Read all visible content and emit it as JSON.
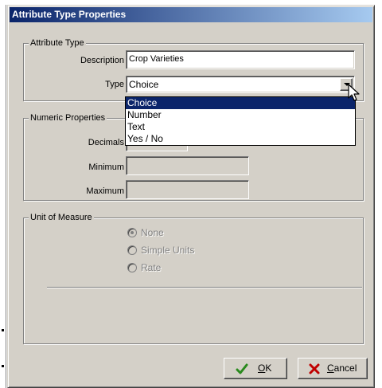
{
  "window": {
    "title": "Attribute Type Properties"
  },
  "attribute_type": {
    "legend": "Attribute Type",
    "description_label": "Description",
    "description_value": "Crop Varieties",
    "type_label": "Type",
    "type_value": "Choice",
    "type_options": [
      "Choice",
      "Number",
      "Text",
      "Yes / No"
    ],
    "type_selected_index": 0
  },
  "numeric_properties": {
    "legend": "Numeric Properties",
    "decimals_label": "Decimals",
    "minimum_label": "Minimum",
    "maximum_label": "Maximum"
  },
  "unit_of_measure": {
    "legend": "Unit of Measure",
    "options": [
      "None",
      "Simple Units",
      "Rate"
    ],
    "selected": "None"
  },
  "buttons": {
    "ok_prefix": "",
    "ok_mnemonic": "O",
    "ok_rest": "K",
    "cancel_mnemonic": "C",
    "cancel_rest": "ancel"
  },
  "icons": {
    "ok": "checkmark-icon",
    "cancel": "x-cross-icon",
    "dropdown": "chevron-down-icon",
    "cursor": "mouse-pointer-icon"
  },
  "colors": {
    "face": "#d4d0c8",
    "title_start": "#0a246a",
    "title_end": "#a6caf0",
    "selection": "#0a246a",
    "ok_check": "#2a8a1e",
    "cancel_cross": "#c00000"
  }
}
